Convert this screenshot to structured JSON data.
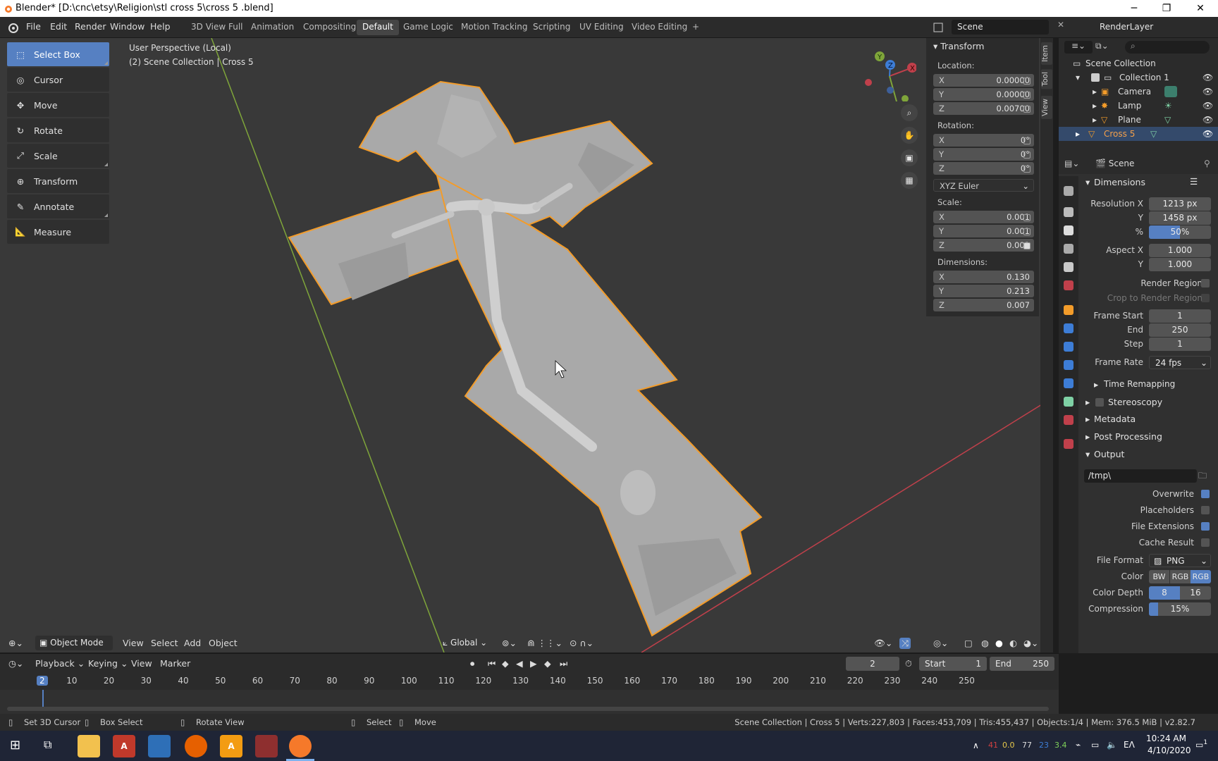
{
  "window": {
    "title": "Blender* [D:\\cnc\\etsy\\Religion\\stl cross 5\\cross 5 .blend]"
  },
  "menu": [
    "File",
    "Edit",
    "Render",
    "Window",
    "Help"
  ],
  "workspaces": [
    "3D View Full",
    "Animation",
    "Compositing",
    "Default",
    "Game Logic",
    "Motion Tracking",
    "Scripting",
    "UV Editing",
    "Video Editing",
    "+"
  ],
  "scene": {
    "name": "Scene",
    "render_layer": "RenderLayer"
  },
  "viewport": {
    "perspective": "User Perspective (Local)",
    "collection": "(2) Scene Collection | Cross 5"
  },
  "tools": [
    "Select Box",
    "Cursor",
    "Move",
    "Rotate",
    "Scale",
    "Transform",
    "Annotate",
    "Measure"
  ],
  "transform": {
    "title": "Transform",
    "location_label": "Location:",
    "location": {
      "x": "0.00000",
      "y": "0.00000",
      "z": "0.00700"
    },
    "rotation_label": "Rotation:",
    "rotation": {
      "x": "0°",
      "y": "0°",
      "z": "0°"
    },
    "euler": "XYZ Euler",
    "scale_label": "Scale:",
    "scale": {
      "x": "0.001",
      "y": "0.001",
      "z": "0.001"
    },
    "dimensions_label": "Dimensions:",
    "dimensions": {
      "x": "0.130",
      "y": "0.213",
      "z": "0.007"
    }
  },
  "sidebar_tabs": [
    "Item",
    "Tool",
    "View"
  ],
  "outliner": {
    "root": "Scene Collection",
    "items": [
      {
        "name": "Collection 1"
      },
      {
        "name": "Camera"
      },
      {
        "name": "Lamp"
      },
      {
        "name": "Plane"
      },
      {
        "name": "Cross 5"
      }
    ]
  },
  "properties": {
    "context": "Scene",
    "dimensions_title": "Dimensions",
    "resolution_x_label": "Resolution X",
    "resolution_x": "1213 px",
    "resolution_y_label": "Y",
    "resolution_y": "1458 px",
    "percent_label": "%",
    "percent": "50%",
    "percent_value": 0.5,
    "aspect_x_label": "Aspect X",
    "aspect_x": "1.000",
    "aspect_y_label": "Y",
    "aspect_y": "1.000",
    "render_region": "Render Region",
    "crop_region": "Crop to Render Region",
    "frame_start_label": "Frame Start",
    "frame_start": "1",
    "end_label": "End",
    "end": "250",
    "step_label": "Step",
    "step": "1",
    "frame_rate_label": "Frame Rate",
    "frame_rate": "24 fps",
    "time_remapping": "Time Remapping",
    "stereoscopy": "Stereoscopy",
    "metadata": "Metadata",
    "post_processing": "Post Processing",
    "output": "Output",
    "output_path": "/tmp\\",
    "overwrite": "Overwrite",
    "placeholders": "Placeholders",
    "file_extensions": "File Extensions",
    "cache_result": "Cache Result",
    "file_format_label": "File Format",
    "file_format": "PNG",
    "color_label": "Color",
    "color_options": [
      "BW",
      "RGB",
      "RGB"
    ],
    "color_depth_label": "Color Depth",
    "color_depth": [
      "8",
      "16"
    ],
    "compression_label": "Compression",
    "compression": "15%",
    "compression_value": 0.15
  },
  "viewport_header": {
    "mode": "Object Mode",
    "menus": [
      "View",
      "Select",
      "Add",
      "Object"
    ],
    "orientation": "Global"
  },
  "timeline": {
    "menus": [
      "Playback",
      "Keying",
      "View",
      "Marker"
    ],
    "current_frame": "2",
    "start_label": "Start",
    "start": "1",
    "end_label": "End",
    "end": "250",
    "ticks": [
      "2",
      "10",
      "20",
      "30",
      "40",
      "50",
      "60",
      "70",
      "80",
      "90",
      "100",
      "110",
      "120",
      "130",
      "140",
      "150",
      "160",
      "170",
      "180",
      "190",
      "200",
      "210",
      "220",
      "230",
      "240",
      "250"
    ]
  },
  "status": {
    "left": [
      "Set 3D Cursor",
      "Box Select",
      "Rotate View",
      "Select",
      "Move"
    ],
    "right": "Scene Collection | Cross 5 | Verts:227,803 | Faces:453,709 | Tris:455,437 | Objects:1/4 | Mem: 376.5 MiB | v2.82.7"
  },
  "taskbar": {
    "time": "10:24 AM",
    "date": "4/10/2020",
    "lang": "EΛ",
    "tray_values": [
      "41",
      "0.0",
      "77",
      "23",
      "3.4"
    ],
    "notification_count": "1"
  },
  "colors": {
    "accent": "#5680c2",
    "selection_outline": "#f39c2a",
    "x_axis": "#c0404b",
    "y_axis": "#7fa53a",
    "model": "#a9a9a9"
  }
}
